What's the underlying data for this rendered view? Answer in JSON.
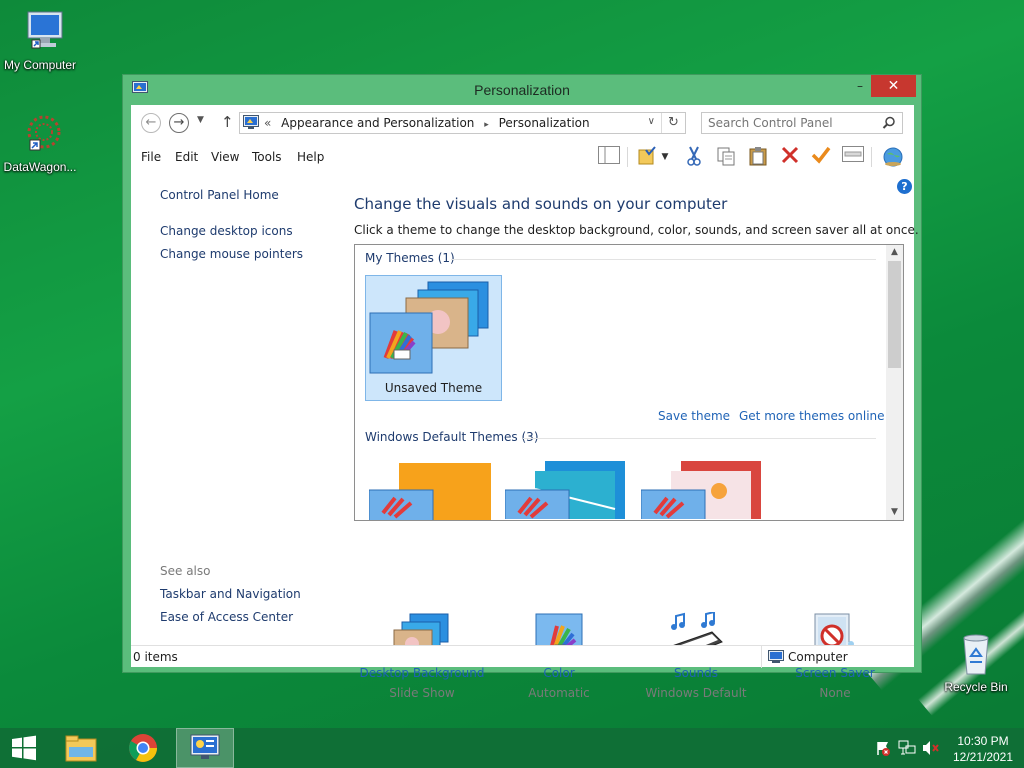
{
  "desktop": {
    "icons": [
      {
        "label": "My Computer",
        "icon": "computer-icon"
      },
      {
        "label": "DataWagon...",
        "icon": "datawagon-icon"
      },
      {
        "label": "Recycle Bin",
        "icon": "recycle-bin-icon"
      }
    ]
  },
  "window": {
    "title": "Personalization",
    "controls": {
      "minimize": "–",
      "maximize": "□",
      "close": "✕"
    }
  },
  "addressbar": {
    "back": "←",
    "forward": "→",
    "up": "↑",
    "overflow": "«",
    "crumbs": [
      "Appearance and Personalization",
      "Personalization"
    ],
    "separator": "▸",
    "search_placeholder": "Search Control Panel"
  },
  "menu": {
    "items": [
      "File",
      "Edit",
      "View",
      "Tools",
      "Help"
    ]
  },
  "toolbar": {
    "icons": [
      "layout-icon",
      "folder-check-icon",
      "dropdown-icon",
      "cut-icon",
      "copy-icon",
      "paste-icon",
      "delete-icon",
      "check-icon",
      "properties-icon",
      "globe-icon"
    ]
  },
  "help": "?",
  "left_pane": {
    "home": "Control Panel Home",
    "links": [
      "Change desktop icons",
      "Change mouse pointers"
    ],
    "see_also_title": "See also",
    "see_also": [
      "Taskbar and Navigation",
      "Ease of Access Center"
    ]
  },
  "main": {
    "heading": "Change the visuals and sounds on your computer",
    "subheading": "Click a theme to change the desktop background, color, sounds, and screen saver all at once.",
    "my_themes": {
      "header": "My Themes (1)",
      "items": [
        {
          "name": "Unsaved Theme"
        }
      ]
    },
    "save_theme": "Save theme",
    "get_more": "Get more themes online",
    "default_themes": {
      "header": "Windows Default Themes (3)"
    },
    "bottom_items": [
      {
        "label": "Desktop Background",
        "sub": "Slide Show",
        "icon": "desktop-background-icon"
      },
      {
        "label": "Color",
        "sub": "Automatic",
        "icon": "color-icon"
      },
      {
        "label": "Sounds",
        "sub": "Windows Default",
        "icon": "sounds-icon"
      },
      {
        "label": "Screen Saver",
        "sub": "None",
        "icon": "screen-saver-icon"
      }
    ]
  },
  "statusbar": {
    "items_text": "0 items",
    "location": "Computer"
  },
  "taskbar": {
    "apps": [
      "start-icon",
      "file-explorer-icon",
      "chrome-icon",
      "control-panel-icon"
    ],
    "tray": [
      "action-center-flag-icon",
      "network-icon",
      "volume-muted-icon"
    ],
    "time": "10:30 PM",
    "date": "12/21/2021"
  },
  "colors": {
    "desktop": "#14a045",
    "window_frame": "#5bbd7c",
    "close_button": "#c7372f",
    "link": "#1f63b6",
    "heading": "#1e3b6e",
    "taskbar": "#106e36"
  }
}
